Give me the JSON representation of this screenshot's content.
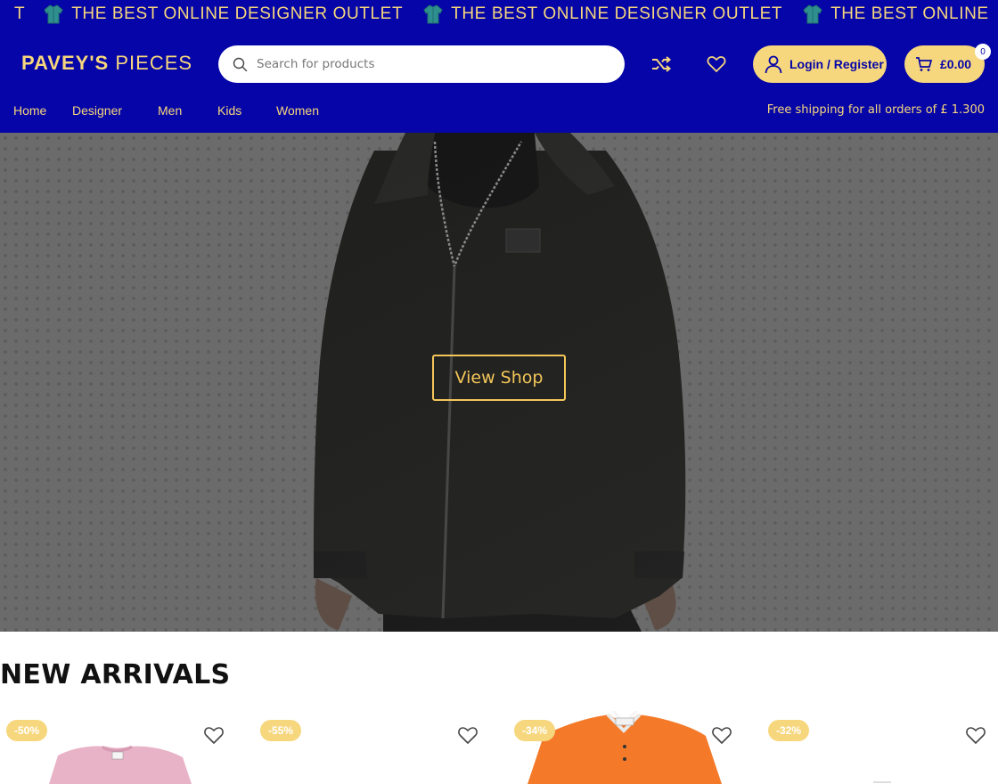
{
  "ticker": {
    "start_text": "T",
    "icon": "jacket-icon",
    "items": [
      "THE BEST ONLINE DESIGNER OUTLET",
      "THE BEST ONLINE DESIGNER OUTLET",
      "THE BEST ONLINE"
    ]
  },
  "header": {
    "logo_bold": "PAVEY'S",
    "logo_light": "PIECES",
    "search_placeholder": "Search for products",
    "login_label": "Login / Register",
    "cart_total": "£0.00",
    "cart_count": "0"
  },
  "nav": {
    "items": [
      "Home",
      "Designer",
      "Men",
      "Kids",
      "Women"
    ],
    "shipping_text": "Free shipping for all orders of £ 1.300"
  },
  "hero": {
    "button_label": "View Shop"
  },
  "arrivals": {
    "title": "NEW ARRIVALS",
    "products": [
      {
        "discount": "-50%",
        "image": "pink-tshirt"
      },
      {
        "discount": "-55%",
        "image": "white-item"
      },
      {
        "discount": "-34%",
        "image": "orange-polo"
      },
      {
        "discount": "-32%",
        "image": "white-item"
      }
    ]
  },
  "colors": {
    "brand_blue": "#0505a8",
    "accent_yellow": "#f7d77d",
    "hero_button": "#f4c659"
  }
}
